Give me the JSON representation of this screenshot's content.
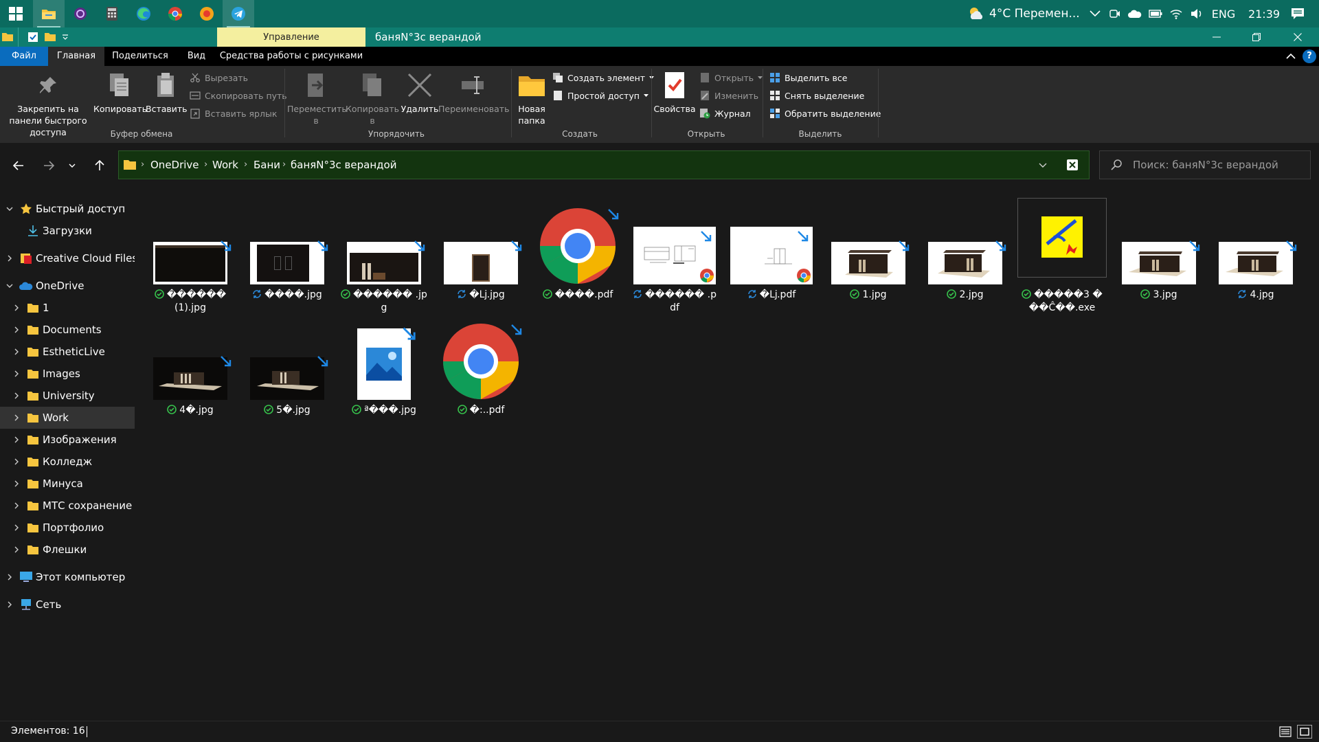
{
  "taskbar": {
    "apps": [
      {
        "icon": "windows-start-icon"
      },
      {
        "icon": "file-explorer-icon"
      },
      {
        "icon": "purple-app-icon"
      },
      {
        "icon": "calculator-icon"
      },
      {
        "icon": "edge-icon"
      },
      {
        "icon": "chrome-icon"
      },
      {
        "icon": "yandex-browser-icon"
      },
      {
        "icon": "telegram-icon"
      }
    ],
    "weather": "4°C  Перемен...",
    "language": "ENG",
    "time": "21:39"
  },
  "titlebar": {
    "contextual_tab": "Управление",
    "title": "баняN°3с верандой"
  },
  "ribbon_tabs": [
    "Файл",
    "Главная",
    "Поделиться",
    "Вид",
    "Средства работы с рисунками"
  ],
  "ribbon": {
    "clipboard": {
      "pin": "Закрепить на панели быстрого доступа",
      "copy": "Копировать",
      "paste": "Вставить",
      "cut": "Вырезать",
      "copy_path": "Скопировать путь",
      "paste_shortcut": "Вставить ярлык",
      "label": "Буфер обмена"
    },
    "organize": {
      "move": "Переместить в",
      "copy_to": "Копировать в",
      "delete": "Удалить",
      "rename": "Переименовать",
      "label": "Упорядочить"
    },
    "create": {
      "new_folder": "Новая папка",
      "new_item": "Создать элемент",
      "easy_access": "Простой доступ",
      "label": "Создать"
    },
    "open": {
      "properties": "Свойства",
      "open": "Открыть",
      "edit": "Изменить",
      "history": "Журнал",
      "label": "Открыть"
    },
    "select": {
      "select_all": "Выделить все",
      "select_none": "Снять выделение",
      "invert": "Обратить выделение",
      "label": "Выделить"
    }
  },
  "address": {
    "crumbs": [
      "OneDrive",
      "Work",
      "Бани",
      "баняN°3с верандой"
    ],
    "search_placeholder": "Поиск: баняN°3с верандой"
  },
  "nav": {
    "quick_access": "Быстрый доступ",
    "downloads": "Загрузки",
    "creative_cloud": "Creative Cloud Files",
    "onedrive": "OneDrive",
    "folders": [
      "1",
      "Documents",
      "EstheticLive",
      "Images",
      "University",
      "Work",
      "Изображения",
      "Колледж",
      "Минуса",
      "МТС сохранение та",
      "Портфолио",
      "Флешки"
    ],
    "this_pc": "Этот компьютер",
    "network": "Сеть"
  },
  "files": [
    {
      "name": "������ (1).jpg",
      "status": "synced",
      "kind": "dark-wide"
    },
    {
      "name": "����.jpg",
      "status": "syncing",
      "kind": "dark-doors"
    },
    {
      "name": "������ .jpg",
      "status": "synced",
      "kind": "sauna-front"
    },
    {
      "name": "�ǈ.jpg",
      "status": "syncing",
      "kind": "sauna-door"
    },
    {
      "name": "����.pdf",
      "status": "synced",
      "kind": "chrome"
    },
    {
      "name": "������ .pdf",
      "status": "syncing",
      "kind": "drawing-pdf"
    },
    {
      "name": "�ǈ.pdf",
      "status": "syncing",
      "kind": "drawing-pdf2"
    },
    {
      "name": "1.jpg",
      "status": "synced",
      "kind": "render"
    },
    {
      "name": "2.jpg",
      "status": "synced",
      "kind": "render"
    },
    {
      "name": "�����3 ���Ĉ��.exe",
      "status": "synced",
      "kind": "exe"
    },
    {
      "name": "3.jpg",
      "status": "synced",
      "kind": "render2"
    },
    {
      "name": "4.jpg",
      "status": "syncing",
      "kind": "render2"
    },
    {
      "name": "4�.jpg",
      "status": "synced",
      "kind": "dark-render"
    },
    {
      "name": "5�.jpg",
      "status": "synced",
      "kind": "dark-render"
    },
    {
      "name": "ª���.jpg",
      "status": "synced",
      "kind": "photo-icon"
    },
    {
      "name": "�:..pdf",
      "status": "synced",
      "kind": "chrome"
    }
  ],
  "statusbar": {
    "count": "Элементов: 16"
  }
}
